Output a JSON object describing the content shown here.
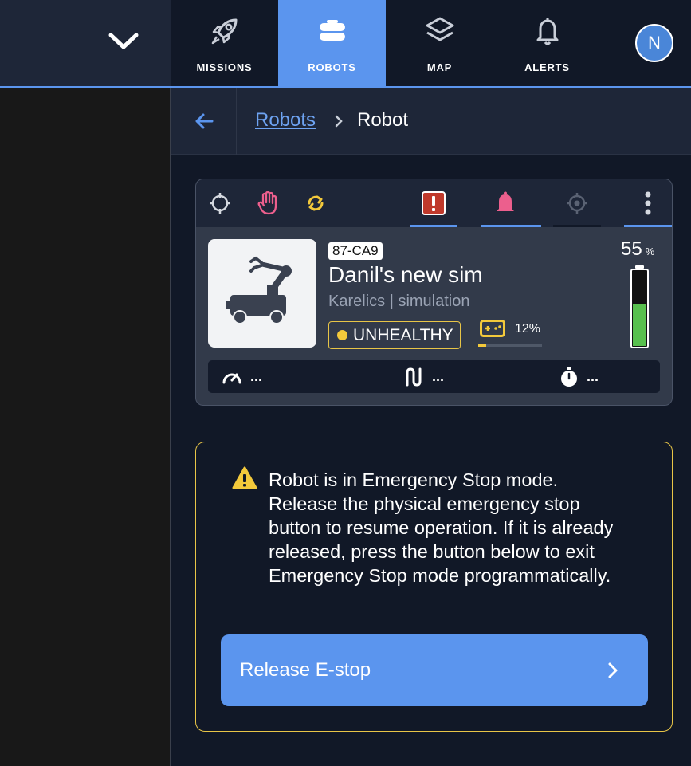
{
  "nav": {
    "tabs": [
      {
        "label": "MISSIONS",
        "icon": "rocket-icon"
      },
      {
        "label": "ROBOTS",
        "icon": "robot-icon",
        "active": true
      },
      {
        "label": "MAP",
        "icon": "layers-icon"
      },
      {
        "label": "ALERTS",
        "icon": "bell-icon"
      }
    ],
    "avatar_initial": "N",
    "accent_color": "#5b95ee"
  },
  "breadcrumb": {
    "parent": "Robots",
    "current": "Robot"
  },
  "robot": {
    "id": "87-CA9",
    "name": "Danil's new sim",
    "subtitle": "Karelics | simulation",
    "health": "UNHEALTHY",
    "control_percent": "12%",
    "control_level": 0.12,
    "battery_value": "55",
    "battery_unit": "%",
    "battery_level": 0.55,
    "stats": [
      {
        "icon": "speedometer-icon",
        "value": "..."
      },
      {
        "icon": "route-icon",
        "value": "..."
      },
      {
        "icon": "stopwatch-icon",
        "value": "..."
      }
    ]
  },
  "toolbar": {
    "icons": [
      "crosshair-icon",
      "hand-stop-icon",
      "sync-icon",
      "emergency-icon",
      "bell-icon",
      "target-icon",
      "more-vertical-icon"
    ]
  },
  "estop": {
    "message": "Robot is in Emergency Stop mode. Release the physical emergency stop button to resume operation. If it is already released, press the button below to exit Emergency Stop mode programmatically.",
    "button_label": "Release E-stop"
  }
}
